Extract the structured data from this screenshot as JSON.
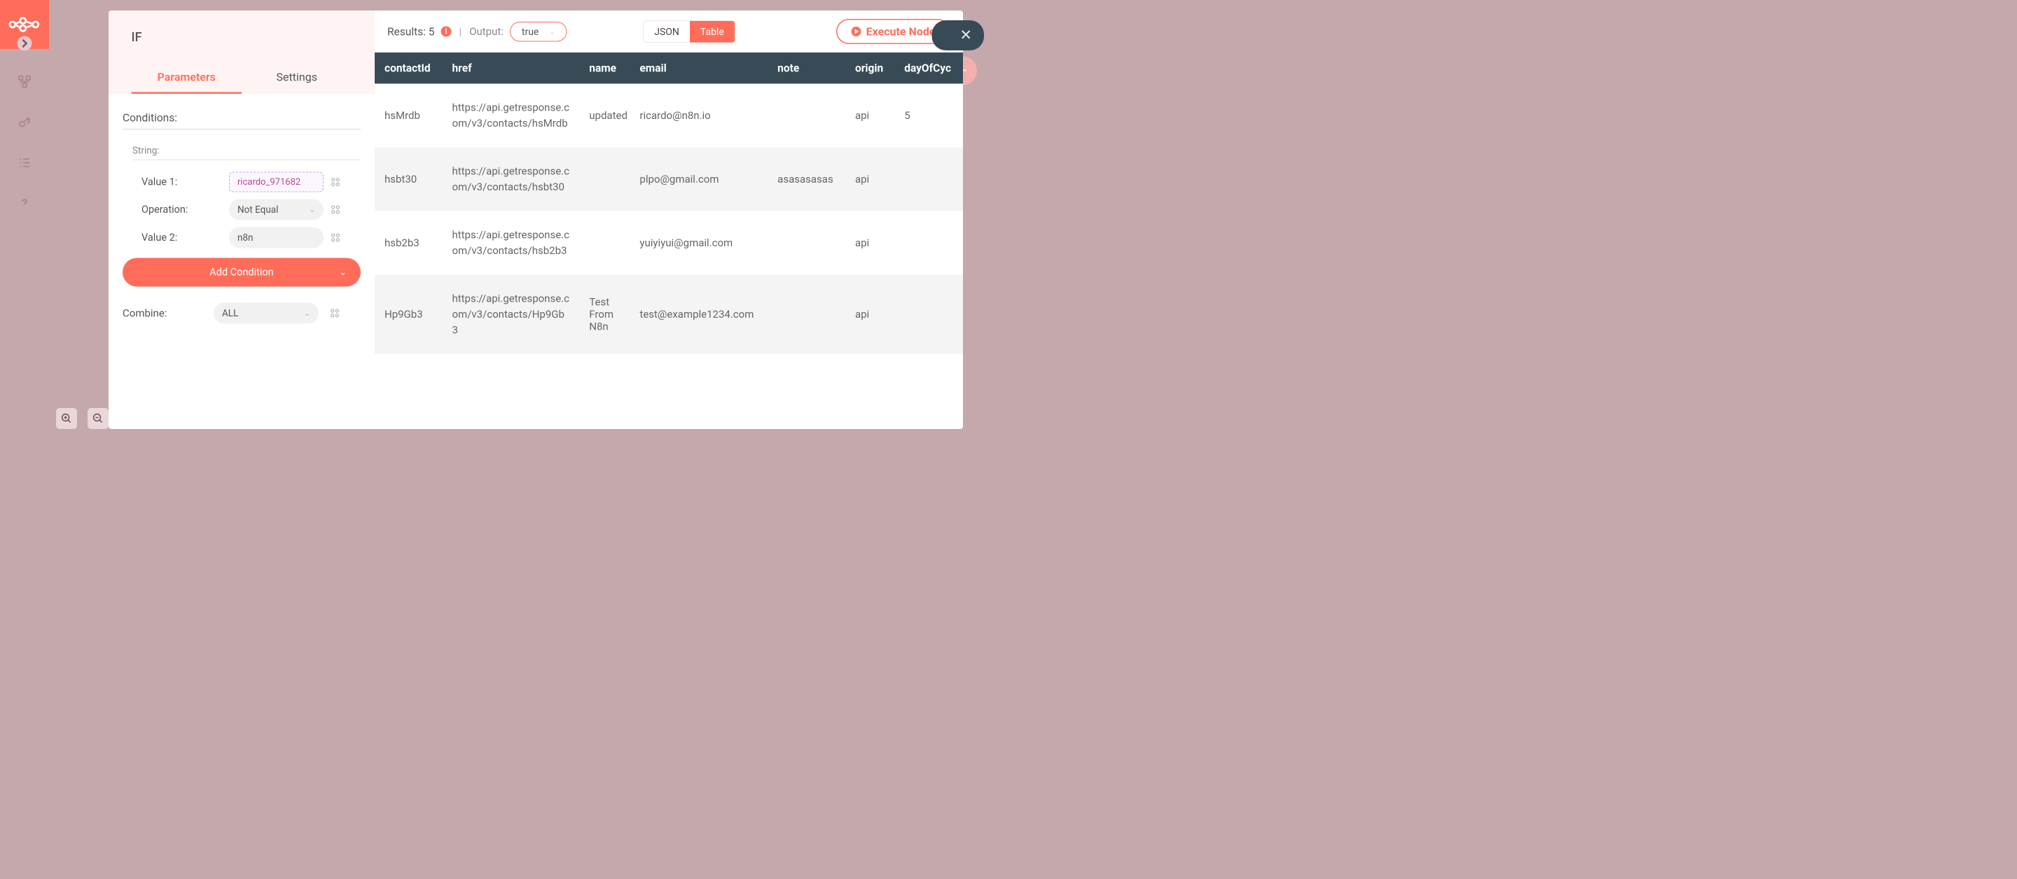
{
  "sidebar": {
    "icons": [
      "workflow-icon",
      "credentials-key-icon",
      "executions-list-icon",
      "help-icon"
    ]
  },
  "fab": {
    "label": "+"
  },
  "node": {
    "title": "IF",
    "tabs": {
      "parameters": "Parameters",
      "settings": "Settings"
    }
  },
  "params": {
    "conditions_label": "Conditions:",
    "string_label": "String:",
    "value1_label": "Value 1:",
    "value1": "ricardo_971682",
    "operation_label": "Operation:",
    "operation": "Not Equal",
    "value2_label": "Value 2:",
    "value2": "n8n",
    "add_condition": "Add Condition",
    "combine_label": "Combine:",
    "combine": "ALL"
  },
  "output": {
    "results_label": "Results: 5",
    "output_label": "Output:",
    "output_value": "true",
    "json_label": "JSON",
    "table_label": "Table",
    "execute_label": "Execute Node"
  },
  "table": {
    "headers": [
      "contactId",
      "href",
      "name",
      "email",
      "note",
      "origin",
      "dayOfCyc"
    ],
    "rows": [
      {
        "contactId": "hsMrdb",
        "href": "https://api.getresponse.com/v3/contacts/hsMrdb",
        "name": "updated",
        "email": "ricardo@n8n.io",
        "note": "",
        "origin": "api",
        "dayOfCycle": "5"
      },
      {
        "contactId": "hsbt30",
        "href": "https://api.getresponse.com/v3/contacts/hsbt30",
        "name": "",
        "email": "plpo@gmail.com",
        "note": "asasasasas",
        "origin": "api",
        "dayOfCycle": ""
      },
      {
        "contactId": "hsb2b3",
        "href": "https://api.getresponse.com/v3/contacts/hsb2b3",
        "name": "",
        "email": "yuiyiyui@gmail.com",
        "note": "",
        "origin": "api",
        "dayOfCycle": ""
      },
      {
        "contactId": "Hp9Gb3",
        "href": "https://api.getresponse.com/v3/contacts/Hp9Gb3",
        "name": "Test From N8n",
        "email": "test@example1234.com",
        "note": "",
        "origin": "api",
        "dayOfCycle": ""
      }
    ]
  }
}
